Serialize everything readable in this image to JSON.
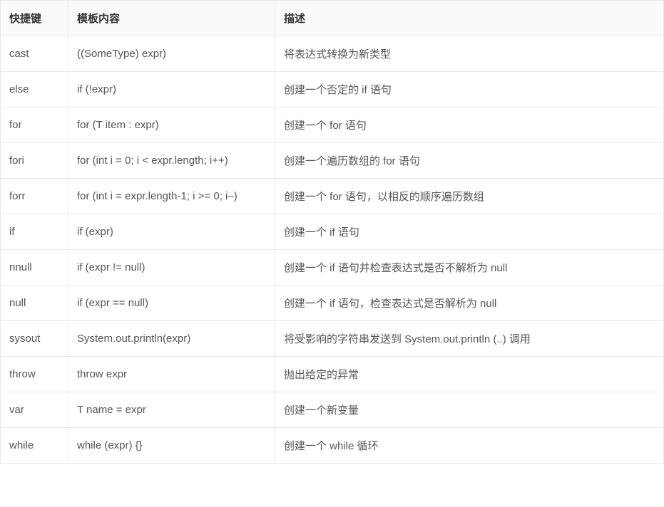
{
  "columns": [
    "快捷键",
    "模板内容",
    "描述"
  ],
  "rows": [
    {
      "shortcut": "cast",
      "template": "((SomeType) expr)",
      "desc": "将表达式转换为新类型"
    },
    {
      "shortcut": "else",
      "template": "if (!expr)",
      "desc": "创建一个否定的 if 语句"
    },
    {
      "shortcut": "for",
      "template": "for (T item : expr)",
      "desc": "创建一个 for 语句"
    },
    {
      "shortcut": "fori",
      "template": "for (int i = 0; i < expr.length; i++)",
      "desc": "创建一个遍历数组的 for 语句"
    },
    {
      "shortcut": "forr",
      "template": "for (int i = expr.length-1; i >= 0; i–)",
      "desc": "创建一个 for 语句，以相反的顺序遍历数组"
    },
    {
      "shortcut": "if",
      "template": "if (expr)",
      "desc": "创建一个 if 语句"
    },
    {
      "shortcut": "nnull",
      "template": "if (expr != null)",
      "desc": "创建一个 if 语句并检查表达式是否不解析为 null"
    },
    {
      "shortcut": "null",
      "template": "if (expr == null)",
      "desc": "创建一个 if 语句，检查表达式是否解析为 null"
    },
    {
      "shortcut": "sysout",
      "template": "System.out.println(expr)",
      "desc": "将受影响的字符串发送到 System.out.println (..) 调用"
    },
    {
      "shortcut": "throw",
      "template": "throw expr",
      "desc": "抛出给定的异常"
    },
    {
      "shortcut": "var",
      "template": "T name = expr",
      "desc": "创建一个新变量"
    },
    {
      "shortcut": "while",
      "template": "while (expr) {}",
      "desc": "创建一个 while 循环"
    }
  ]
}
